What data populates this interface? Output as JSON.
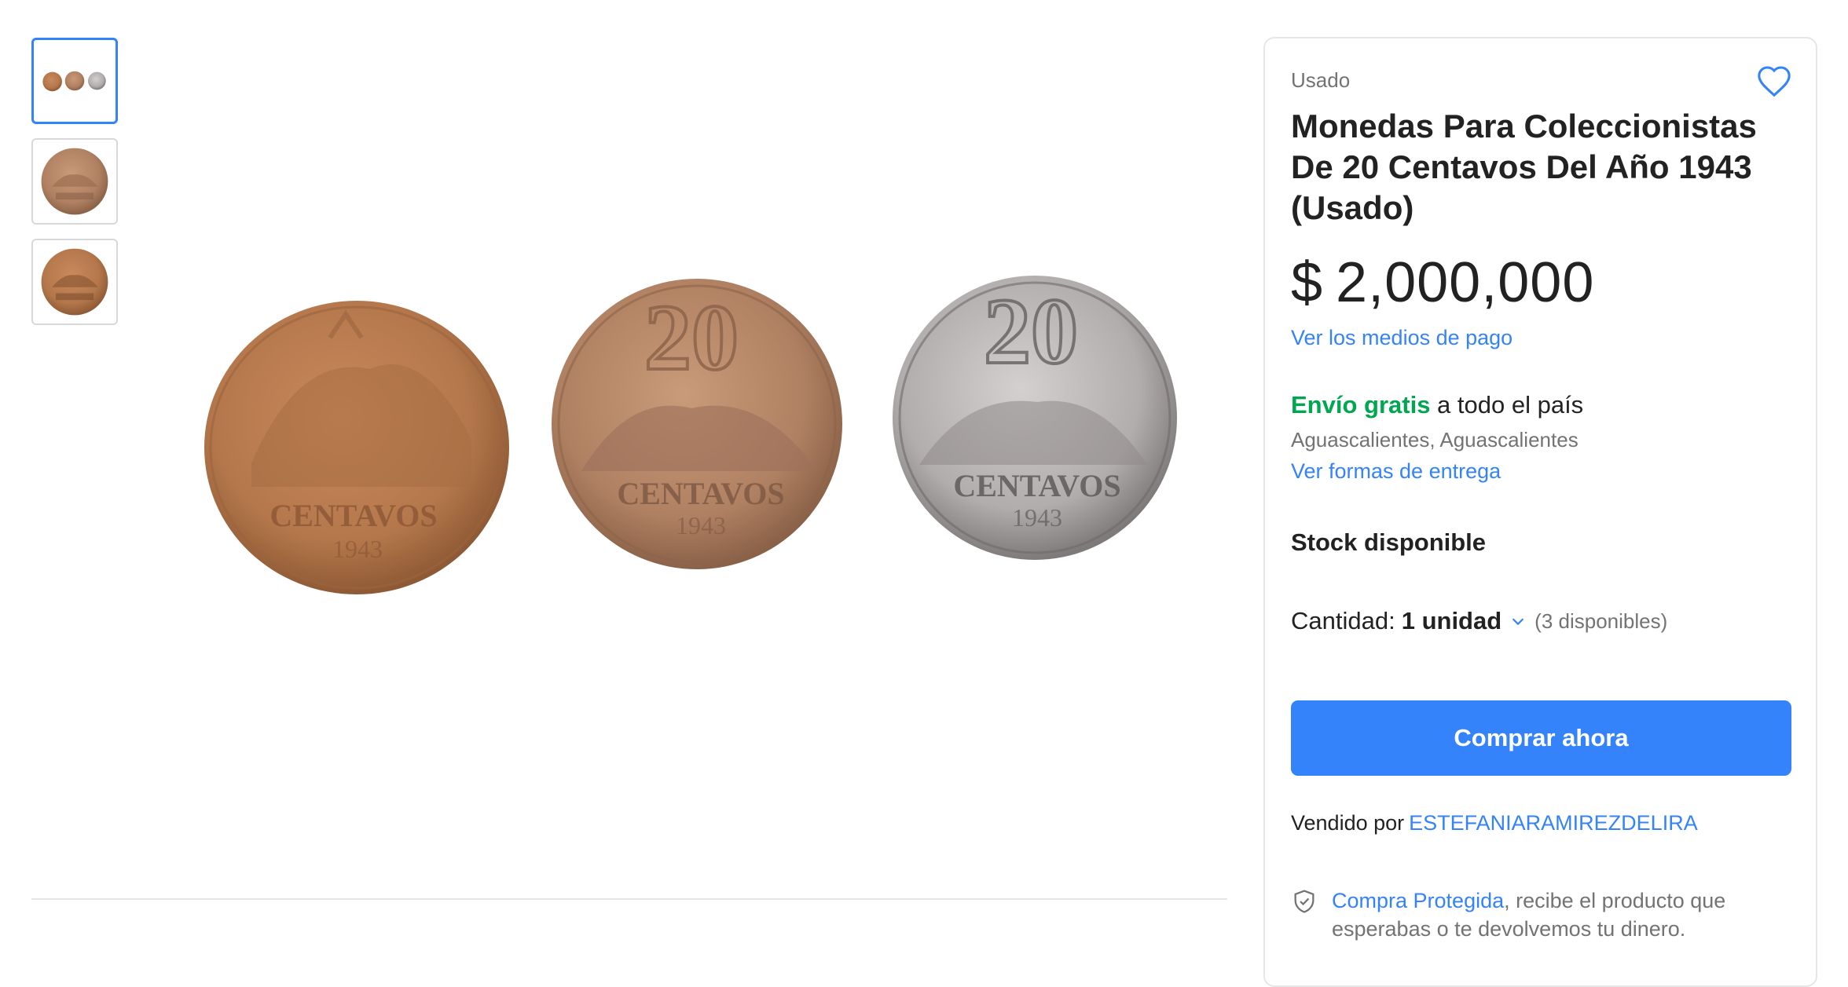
{
  "gallery": {
    "thumbnails": [
      {
        "name": "thumbnail-1",
        "active": true
      },
      {
        "name": "thumbnail-2",
        "active": false
      },
      {
        "name": "thumbnail-3",
        "active": false
      }
    ],
    "coins": [
      {
        "top_text": "",
        "label": "CENTAVOS",
        "year": "1943",
        "metal": "bronze"
      },
      {
        "top_text": "20",
        "label": "CENTAVOS",
        "year": "1943",
        "metal": "bronze"
      },
      {
        "top_text": "20",
        "label": "CENTAVOS",
        "year": "1943",
        "metal": "silver"
      }
    ]
  },
  "product": {
    "condition": "Usado",
    "title": "Monedas Para Coleccionistas De 20 Centavos Del Año 1943 (Usado)",
    "price_currency": "$",
    "price_amount": "2,000,000",
    "payment_link": "Ver los medios de pago"
  },
  "shipping": {
    "free_label": "Envío gratis",
    "coverage": " a todo el país",
    "location": "Aguascalientes, Aguascalientes",
    "delivery_link": "Ver formas de entrega"
  },
  "stock": {
    "label": "Stock disponible",
    "quantity_label": "Cantidad:",
    "quantity_value": "1 unidad",
    "available": "(3 disponibles)"
  },
  "actions": {
    "buy_now": "Comprar ahora"
  },
  "seller": {
    "prefix": "Vendido por",
    "name": "ESTEFANIARAMIREZDELIRA"
  },
  "protection": {
    "link": "Compra Protegida",
    "text": ", recibe el producto que esperabas o te devolvemos tu dinero."
  },
  "icons": {
    "favorite": "heart-icon",
    "quantity": "chevron-down-icon",
    "protection": "shield-check-icon"
  },
  "colors": {
    "accent": "#3483fa",
    "free_shipping": "#00a650",
    "muted": "#737373",
    "coin_bronze": "#b4774b",
    "coin_silver": "#b8b3b3"
  }
}
